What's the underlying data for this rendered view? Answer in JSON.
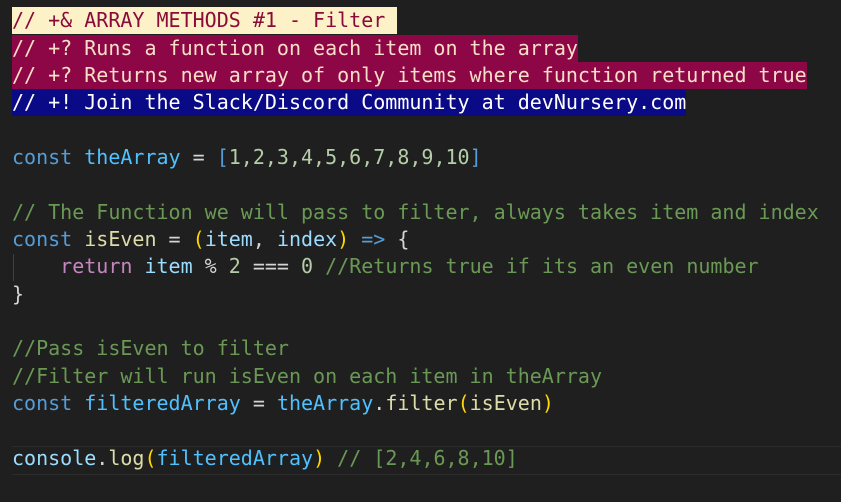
{
  "editor": {
    "lines": {
      "l1": "// +& ARRAY METHODS #1 - Filter ",
      "l2": "// +? Runs a function on each item on the array",
      "l3": "// +? Returns new array of only items where function returned true",
      "l4": "// +! Join the Slack/Discord Community at devNursery.com",
      "l5_kw": "const",
      "l5_var": "theArray",
      "l5_eq": " = ",
      "l5_arr_open": "[",
      "l5_nums": "1,2,3,4,5,6,7,8,9,10",
      "l5_arr_close": "]",
      "l6": "// The Function we will pass to filter, always takes item and index",
      "l7_kw": "const",
      "l7_fn": "isEven",
      "l7_eq": " = ",
      "l7_po": "(",
      "l7_p1": "item",
      "l7_comma": ", ",
      "l7_p2": "index",
      "l7_pc": ")",
      "l7_arrow": " => ",
      "l7_brace": "{",
      "l8_ret": "return",
      "l8_item": "item",
      "l8_mod": " % ",
      "l8_two": "2",
      "l8_eqeq": " === ",
      "l8_zero": "0",
      "l8_cm": " //Returns true if its an even number",
      "l9": "}",
      "l10": "//Pass isEven to filter",
      "l11": "//Filter will run isEven on each item in theArray",
      "l12_kw": "const",
      "l12_var": "filteredArray",
      "l12_eq": " = ",
      "l12_obj": "theArray",
      "l12_dot": ".",
      "l12_method": "filter",
      "l12_po": "(",
      "l12_arg": "isEven",
      "l12_pc": ")",
      "l13_obj": "console",
      "l13_dot": ".",
      "l13_method": "log",
      "l13_po": "(",
      "l13_arg": "filteredArray",
      "l13_pc": ")",
      "l13_cm": " // [2,4,6,8,10]"
    }
  }
}
